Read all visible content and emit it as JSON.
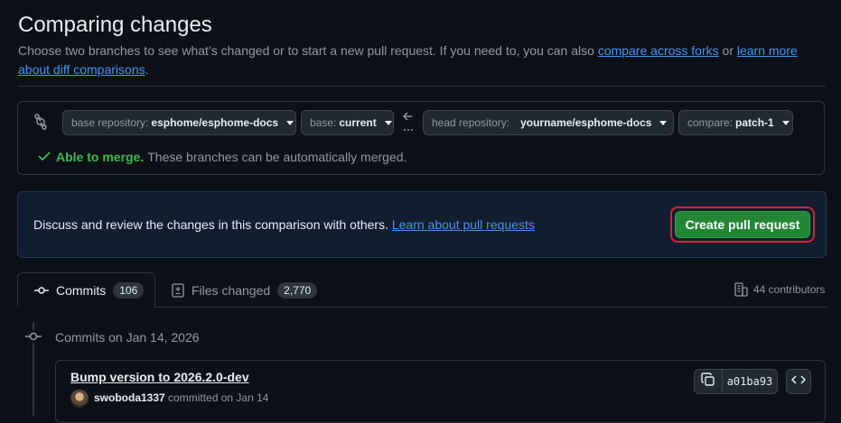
{
  "header": {
    "title": "Comparing changes",
    "subtitle_text": "Choose two branches to see what’s changed or to start a new pull request. If you need to, you can also",
    "link_compare_forks": "compare across forks",
    "or_text": "or",
    "link_learn_diff": "learn more about diff comparisons",
    "period": "."
  },
  "range": {
    "base_repo_label": "base repository:",
    "base_repo_value": "esphome/esphome-docs",
    "base_label": "base:",
    "base_value": "current",
    "head_repo_label": "head repository:",
    "head_repo_value": "yourname/esphome-docs",
    "compare_label": "compare:",
    "compare_value": "patch-1",
    "merge_ok": "Able to merge.",
    "merge_text": "These branches can be automatically merged."
  },
  "pr_prompt": {
    "text": "Discuss and review the changes in this comparison with others.",
    "link": "Learn about pull requests",
    "button": "Create pull request"
  },
  "tabs": [
    {
      "label": "Commits",
      "count": "106"
    },
    {
      "label": "Files changed",
      "count": "2,770"
    }
  ],
  "contributors": "44 contributors",
  "commit_group": {
    "label": "Commits on Jan 14, 2026"
  },
  "commit": {
    "title": "Bump version to 2026.2.0-dev",
    "author": "swoboda1337",
    "meta": "committed on Jan 14",
    "sha": "a01ba93"
  },
  "colors": {
    "accent": "#4493f8",
    "success": "#3fb950",
    "button_green": "#238636",
    "highlight_red": "#d1242f"
  }
}
